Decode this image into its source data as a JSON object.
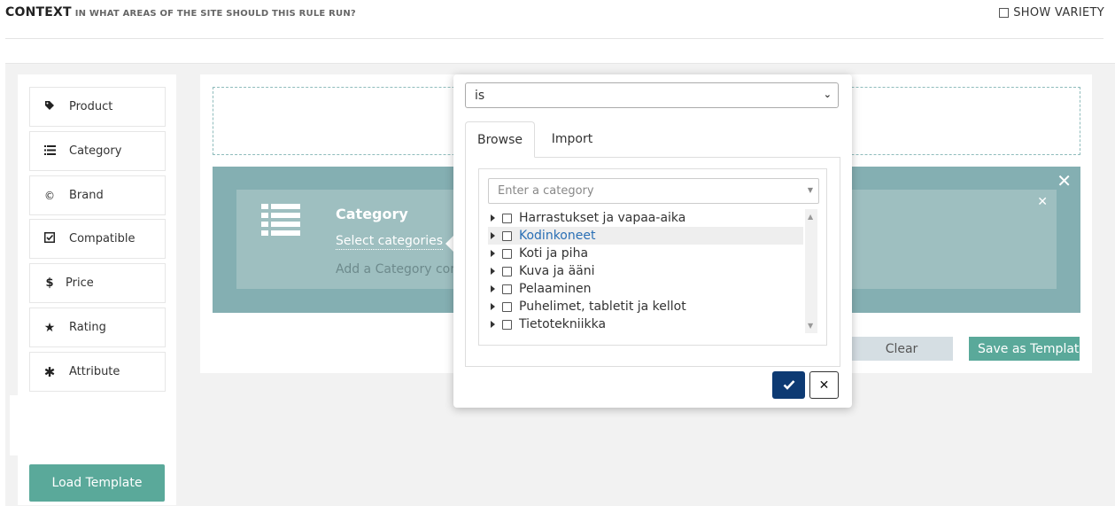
{
  "header": {
    "title": "CONTEXT",
    "subtitle": "IN WHAT AREAS OF THE SITE SHOULD THIS RULE RUN?",
    "show_variety_label": "SHOW VARIETY"
  },
  "sidebar": {
    "items": [
      {
        "label": "Product",
        "icon": "tag-icon"
      },
      {
        "label": "Category",
        "icon": "list-icon"
      },
      {
        "label": "Brand",
        "icon": "copyright-icon"
      },
      {
        "label": "Compatible",
        "icon": "check-square-icon"
      },
      {
        "label": "Price",
        "icon": "dollar-icon"
      },
      {
        "label": "Rating",
        "icon": "star-icon"
      },
      {
        "label": "Attribute",
        "icon": "asterisk-icon"
      }
    ],
    "load_template_label": "Load Template"
  },
  "rule": {
    "title": "Category",
    "select_link": "Select categories",
    "description": "Add a Category cor"
  },
  "actions": {
    "clear_label": "Clear",
    "save_template_label": "Save as Templat"
  },
  "popup": {
    "operator": "is",
    "tabs": [
      {
        "label": "Browse",
        "active": true
      },
      {
        "label": "Import",
        "active": false
      }
    ],
    "category_placeholder": "Enter a category",
    "categories": [
      {
        "label": "Harrastukset ja vapaa-aika",
        "highlighted": false
      },
      {
        "label": "Kodinkoneet",
        "highlighted": true
      },
      {
        "label": "Koti ja piha",
        "highlighted": false
      },
      {
        "label": "Kuva ja ääni",
        "highlighted": false
      },
      {
        "label": "Pelaaminen",
        "highlighted": false
      },
      {
        "label": "Puhelimet, tabletit ja kellot",
        "highlighted": false
      },
      {
        "label": "Tietotekniikka",
        "highlighted": false
      }
    ]
  },
  "colors": {
    "accent": "#5aa99a",
    "rule_bg": "#84afb2",
    "confirm": "#0d3a73"
  }
}
